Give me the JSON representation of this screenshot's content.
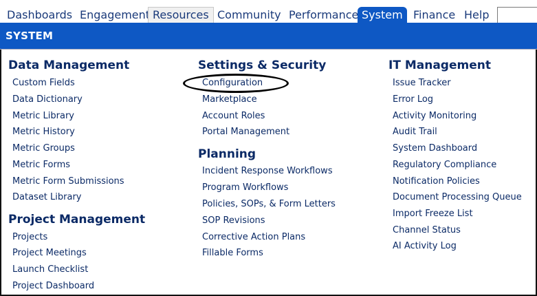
{
  "nav": {
    "items": [
      "Dashboards",
      "Engagement",
      "Resources",
      "Community",
      "Performance",
      "System",
      "Finance",
      "Help"
    ],
    "active": "System",
    "search_value": ""
  },
  "banner": {
    "title": "SYSTEM"
  },
  "columns": {
    "data_management": {
      "title": "Data Management",
      "links": [
        "Custom Fields",
        "Data Dictionary",
        "Metric Library",
        "Metric History",
        "Metric Groups",
        "Metric Forms",
        "Metric Form Submissions",
        "Dataset Library"
      ]
    },
    "project_management": {
      "title": "Project Management",
      "links": [
        "Projects",
        "Project Meetings",
        "Launch Checklist",
        "Project Dashboard"
      ]
    },
    "settings_security": {
      "title": "Settings & Security",
      "links": [
        "Configuration",
        "Marketplace",
        "Account Roles",
        "Portal Management"
      ]
    },
    "planning": {
      "title": "Planning",
      "links": [
        "Incident Response Workflows",
        "Program Workflows",
        "Policies, SOPs, & Form Letters",
        "SOP Revisions",
        "Corrective Action Plans",
        "Fillable Forms"
      ]
    },
    "it_management": {
      "title": "IT Management",
      "links": [
        "Issue Tracker",
        "Error Log",
        "Activity Monitoring",
        "Audit Trail",
        "System Dashboard",
        "Regulatory Compliance",
        "Notification Policies",
        "Document Processing Queue",
        "Import Freeze List",
        "Channel Status",
        "AI Activity Log"
      ]
    }
  },
  "colors": {
    "brand": "#0e58c4",
    "link": "#0b2a66",
    "annotation": "#000000"
  }
}
